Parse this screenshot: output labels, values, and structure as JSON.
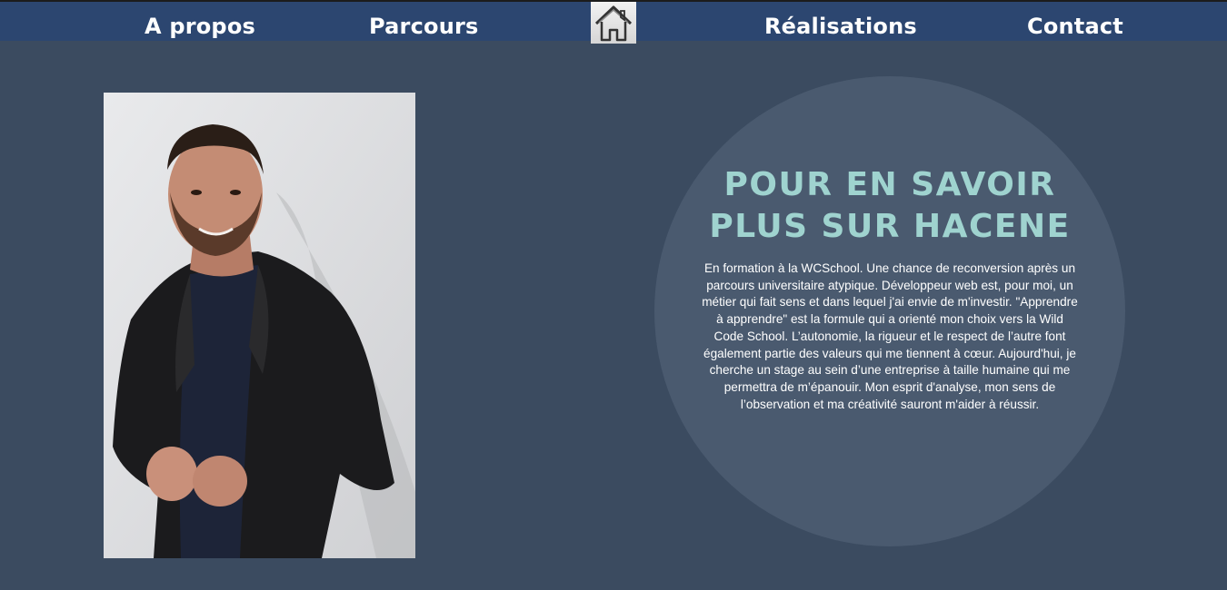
{
  "nav": {
    "items": [
      {
        "label": "A propos"
      },
      {
        "label": "Parcours"
      },
      {
        "label": "Réalisations"
      },
      {
        "label": "Contact"
      }
    ],
    "home_icon": "home-icon"
  },
  "about": {
    "photo_subject": "portrait-photo",
    "title": "POUR EN SAVOIR PLUS SUR HACENE",
    "text": "En formation à la WCSchool. Une chance de reconversion après un parcours universitaire atypique. Développeur web est, pour moi, un métier qui fait sens et dans lequel j'ai envie de m'investir. \"Apprendre à apprendre\" est la formule qui a orienté mon choix vers la Wild Code School. L’autonomie, la rigueur et le respect de l’autre font également partie des valeurs qui me tiennent à cœur. Aujourd'hui, je cherche un stage au sein d’une entreprise à taille humaine qui me permettra de m’épanouir. Mon esprit d'analyse, mon sens de l’observation et ma créativité sauront m'aider à réussir."
  },
  "colors": {
    "background": "#3b4b60",
    "navbar": "#2c4670",
    "circle": "#4a5a6f",
    "title": "#9fd3cf"
  }
}
